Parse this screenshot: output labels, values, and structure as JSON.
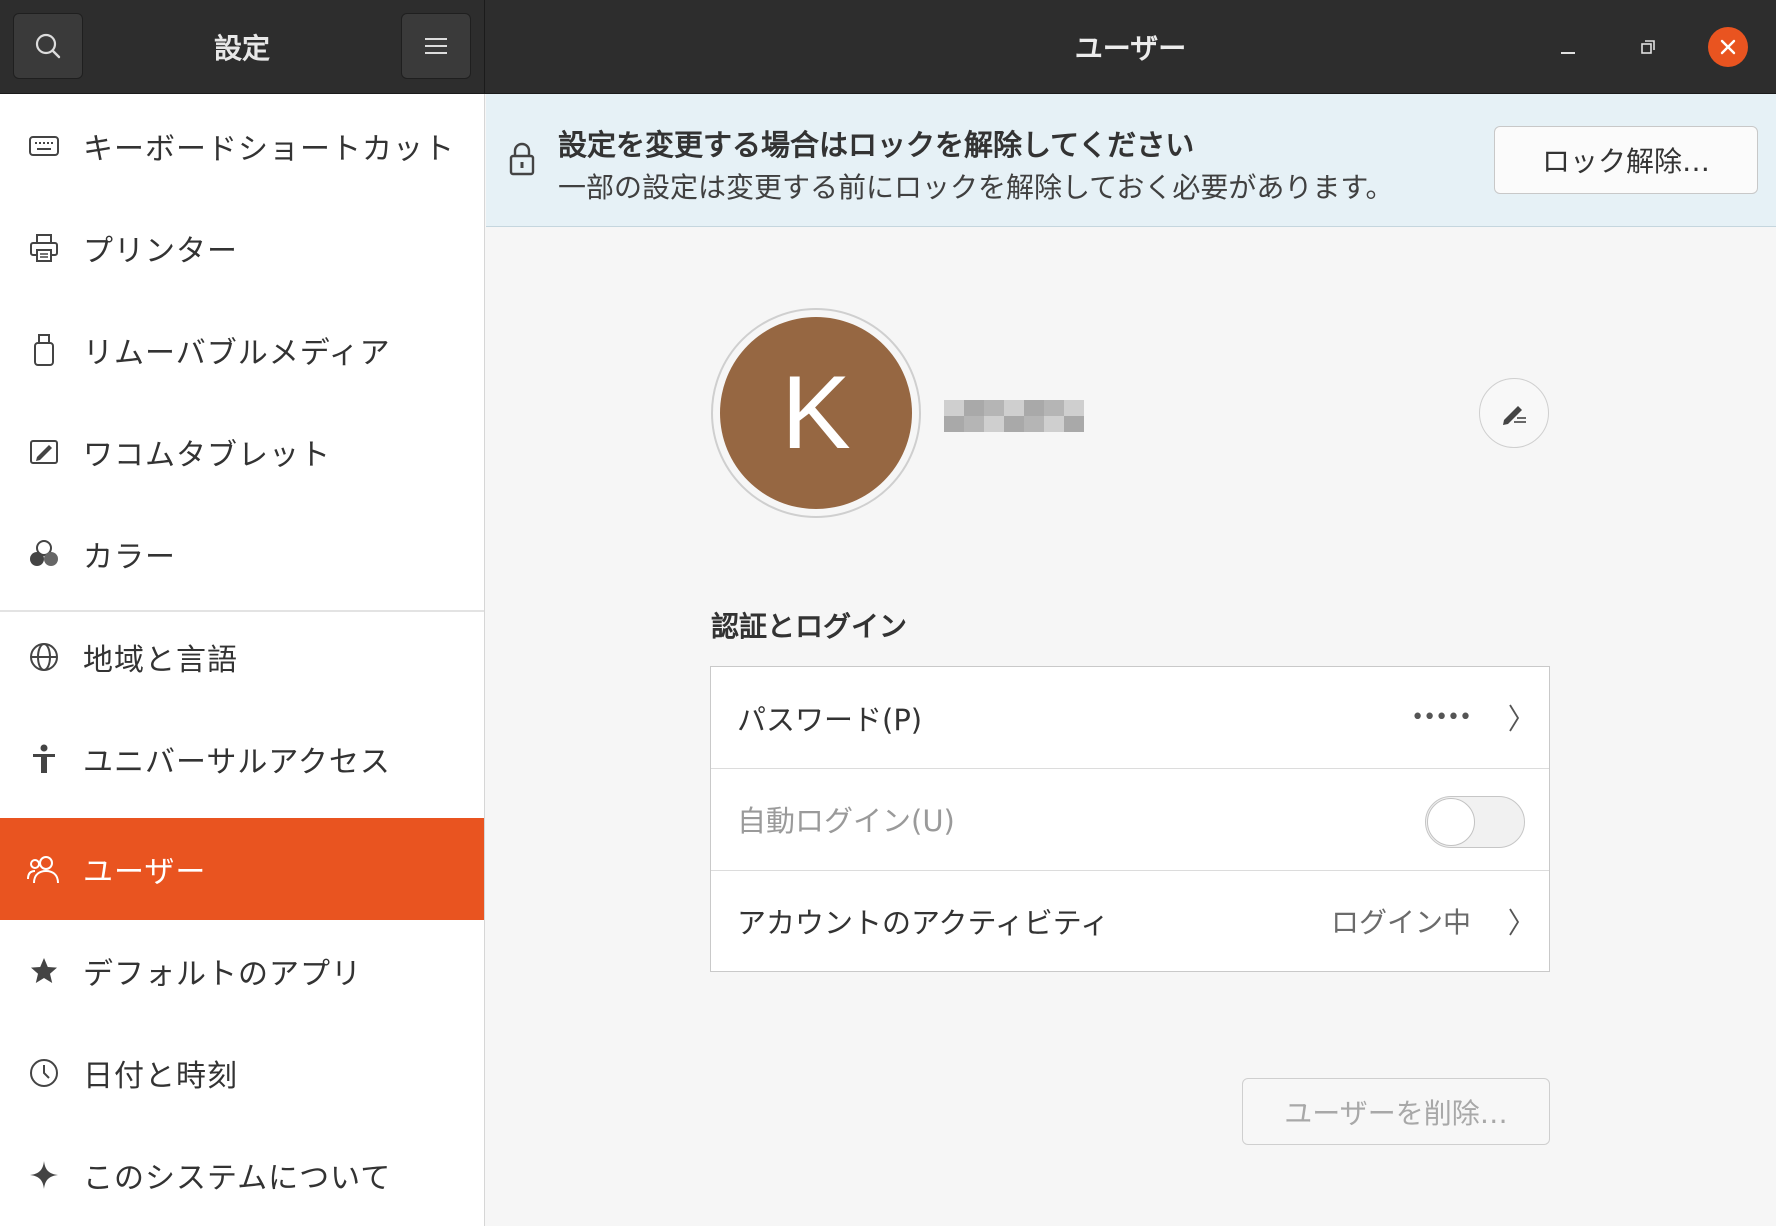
{
  "headerbar": {
    "left_title": "設定",
    "right_title": "ユーザー"
  },
  "sidebar": {
    "items": [
      {
        "label": "キーボードショートカット",
        "icon": "keyboard-icon"
      },
      {
        "label": "プリンター",
        "icon": "printer-icon"
      },
      {
        "label": "リムーバブルメディア",
        "icon": "removable-media-icon"
      },
      {
        "label": "ワコムタブレット",
        "icon": "tablet-icon"
      },
      {
        "label": "カラー",
        "icon": "color-icon"
      },
      {
        "label": "地域と言語",
        "icon": "globe-icon"
      },
      {
        "label": "ユニバーサルアクセス",
        "icon": "accessibility-icon"
      },
      {
        "label": "ユーザー",
        "icon": "users-icon"
      },
      {
        "label": "デフォルトのアプリ",
        "icon": "star-icon"
      },
      {
        "label": "日付と時刻",
        "icon": "clock-icon"
      },
      {
        "label": "このシステムについて",
        "icon": "sparkle-icon"
      }
    ],
    "active_label": "ユーザー"
  },
  "infobar": {
    "title": "設定を変更する場合はロックを解除してください",
    "subtitle": "一部の設定は変更する前にロックを解除しておく必要があります。",
    "unlock_button": "ロック解除…"
  },
  "user": {
    "avatar_initial": "K",
    "avatar_color": "#966742"
  },
  "auth": {
    "section_title": "認証とログイン",
    "password_label": "パスワード(P)",
    "password_value": "•••••",
    "autologin_label": "自動ログイン(U)",
    "autologin_enabled": false,
    "activity_label": "アカウントのアクティビティ",
    "activity_value": "ログイン中"
  },
  "remove_button": "ユーザーを削除…",
  "colors": {
    "accent": "#e95420",
    "headerbar": "#2d2d2d",
    "infobar": "#e6f1f6"
  }
}
